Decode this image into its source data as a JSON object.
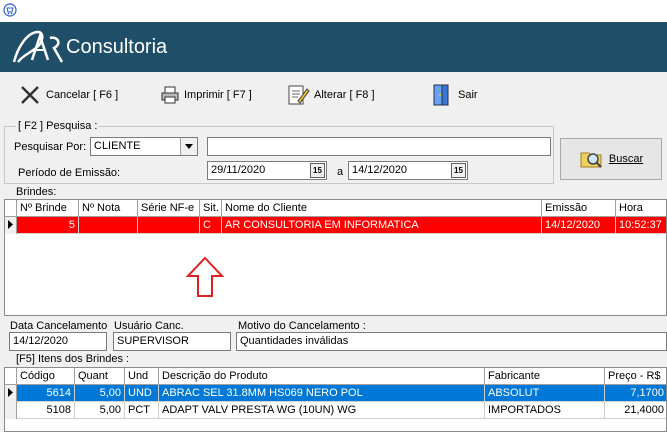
{
  "app": {
    "brand": "Consultoria",
    "logo_text": "AR"
  },
  "toolbar": {
    "cancel_label": "Cancelar [ F6 ]",
    "print_label": "Imprimir  [ F7 ]",
    "edit_label": "Alterar [ F8 ]",
    "exit_label": "Sair"
  },
  "search": {
    "group_title": "[ F2 ]  Pesquisa :",
    "search_by_label": "Pesquisar Por:",
    "search_by_value": "CLIENTE",
    "search_text": "",
    "period_label": "Período de Emissão:",
    "date_from": "29/11/2020",
    "date_sep": "a",
    "date_to": "14/12/2020",
    "search_button": "Buscar",
    "calendar_glyph": "15"
  },
  "brindes": {
    "title": "Brindes:",
    "columns": [
      "Nº Brinde",
      "Nº Nota",
      "Série NF-e",
      "Sit.",
      "Nome do Cliente",
      "Emissão",
      "Hora"
    ],
    "rows": [
      {
        "brinde": "5",
        "nota": "",
        "serie": "",
        "sit": "C",
        "cliente": "AR CONSULTORIA EM INFORMATICA",
        "emissao": "14/12/2020",
        "hora": "10:52:37"
      }
    ]
  },
  "cancel_info": {
    "date_label": "Data Cancelamento",
    "date_value": "14/12/2020",
    "user_label": "Usuário Canc.",
    "user_value": "SUPERVISOR",
    "reason_label": "Motivo do Cancelamento  :",
    "reason_value": "Quantidades inválidas"
  },
  "itens": {
    "title": "[F5]  Itens dos Brindes  :",
    "columns": [
      "Código",
      "Quant",
      "Und",
      "Descrição do Produto",
      "Fabricante",
      "Preço - R$"
    ],
    "rows": [
      {
        "codigo": "5614",
        "quant": "5,00",
        "und": "UND",
        "descricao": "ABRAC SEL 31.8MM HS069 NERO POL",
        "fabricante": "ABSOLUT",
        "preco": "7,1700"
      },
      {
        "codigo": "5108",
        "quant": "5,00",
        "und": "PCT",
        "descricao": "ADAPT VALV PRESTA WG (10UN) WG",
        "fabricante": "IMPORTADOS",
        "preco": "21,4000"
      }
    ]
  },
  "colors": {
    "header_bg": "#1f4e69",
    "selected_red": "#ff0000",
    "selected_blue": "#0078d7",
    "annotation_arrow": "#e02020"
  }
}
